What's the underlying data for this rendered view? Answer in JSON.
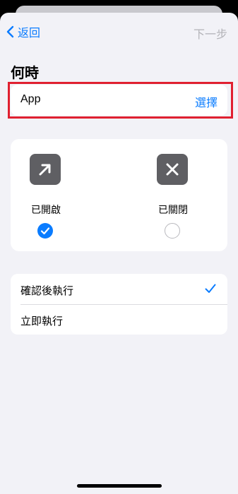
{
  "nav": {
    "back_label": "返回",
    "next_label": "下一步"
  },
  "section": {
    "title": "何時"
  },
  "app_row": {
    "label": "App",
    "action_label": "選擇"
  },
  "toggle_options": [
    {
      "label": "已開啟",
      "icon": "arrow-up-right-icon",
      "selected": true
    },
    {
      "label": "已關閉",
      "icon": "close-x-icon",
      "selected": false
    }
  ],
  "run_modes": [
    {
      "label": "確認後執行",
      "selected": true
    },
    {
      "label": "立即執行",
      "selected": false
    }
  ],
  "colors": {
    "accent": "#0a7cff",
    "highlight": "#e02030",
    "tile": "#5f5f63",
    "disabled_text": "#b3b3b8",
    "background": "#f2f2f7"
  }
}
